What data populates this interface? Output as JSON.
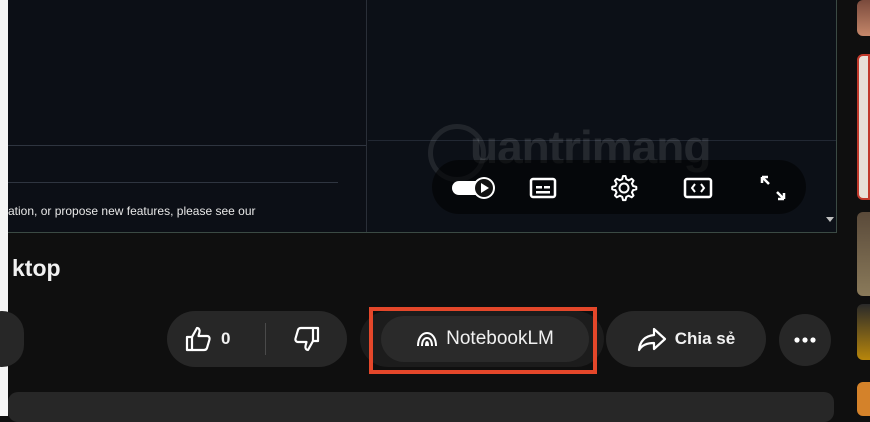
{
  "player": {
    "doc_text": "ation, or propose new features, please see our",
    "watermark": "uantrimang",
    "controls": {
      "autoplay": "autoplay-toggle",
      "subtitles": "subtitles-icon",
      "settings": "settings-gear-icon",
      "miniplayer": "miniplayer-icon",
      "fullscreen": "fullscreen-icon"
    }
  },
  "video": {
    "title": "ktop"
  },
  "actions": {
    "like_count": "0",
    "notebook_label": "NotebookLM",
    "share_label": "Chia sẻ"
  },
  "colors": {
    "highlight": "#e4472a",
    "button_bg": "#272727",
    "page_bg": "#0f0f0f"
  }
}
